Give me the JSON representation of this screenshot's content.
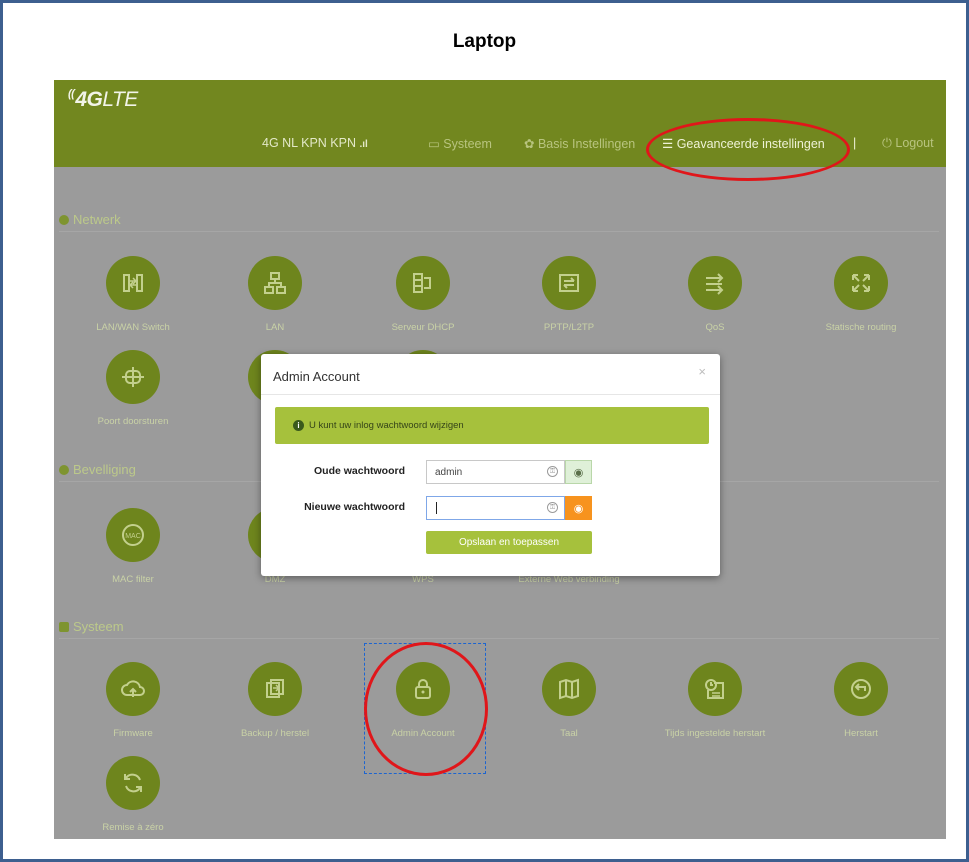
{
  "caption": "Laptop",
  "header": {
    "logo_prefix": "4G",
    "logo_suffix": "LTE",
    "nav": {
      "network_status": "4G  NL KPN KPN",
      "system": "Systeem",
      "basic_settings": "Basis Instellingen",
      "advanced_settings": "Geavanceerde instellingen",
      "separator": "|",
      "logout": "Logout"
    }
  },
  "sections": {
    "network": "Netwerk",
    "security": "Bevelliging",
    "system": "Systeem"
  },
  "network_tiles": [
    "LAN/WAN Switch",
    "LAN",
    "Serveur DHCP",
    "PPTP/L2TP",
    "QoS",
    "Statische routing",
    "Poort doorsturen"
  ],
  "security_tiles": [
    "MAC filter",
    "DMZ",
    "WPS",
    "Externe Web verbinding"
  ],
  "system_tiles": [
    "Firmware",
    "Backup / herstel",
    "Admin Account",
    "Taal",
    "Tijds ingestelde herstart",
    "Herstart",
    "Remise à zéro"
  ],
  "modal": {
    "title": "Admin Account",
    "close": "×",
    "alert_icon": "i",
    "alert_text": "U kunt uw inlog wachtwoord wijzigen",
    "old_password_label": "Oude wachtwoord",
    "old_password_value": "admin",
    "new_password_label": "Nieuwe wachtwoord",
    "new_password_value": "",
    "save_button": "Opslaan en toepassen"
  },
  "colors": {
    "brand_green": "#72871f",
    "accent_green": "#a6c13c",
    "orange": "#f7931e",
    "highlight_red": "#e0161a"
  },
  "icons": [
    "signal-icon",
    "monitor-icon",
    "gear-icon",
    "sliders-icon",
    "power-icon",
    "globe-icon",
    "shield-icon",
    "grid-icon",
    "info-icon",
    "key-icon",
    "eye-icon",
    "eye-slash-icon"
  ]
}
